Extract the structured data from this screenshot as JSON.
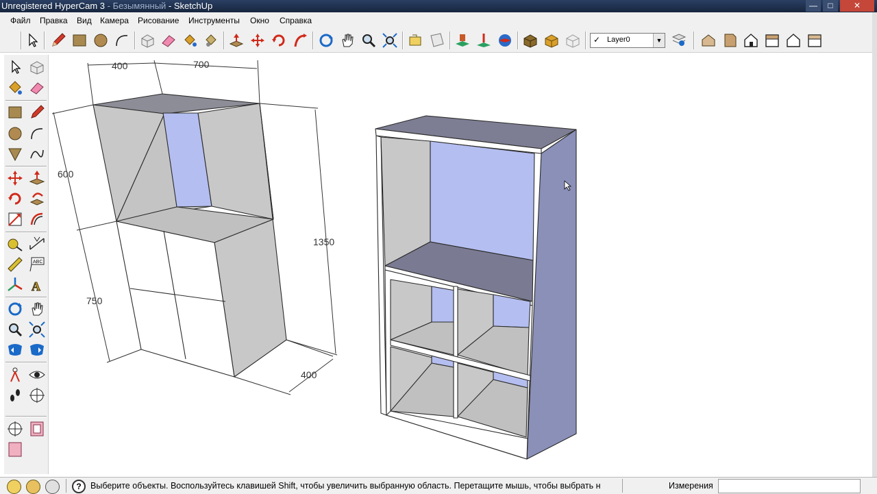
{
  "window": {
    "title_faded": "Unregistered HyperCam 3",
    "title_sep": " - ",
    "title_obscured": "Безымянный",
    "title_app": "SketchUp"
  },
  "menu": [
    "Файл",
    "Правка",
    "Вид",
    "Камера",
    "Рисование",
    "Инструменты",
    "Окно",
    "Справка"
  ],
  "toolbar": {
    "layer_value": "Layer0",
    "layer_check": "✓",
    "tools": [
      "select-tool",
      "pencil-tool",
      "rectangle-tool",
      "circle-tool",
      "arc-tool",
      "make-component-tool",
      "eraser-tool",
      "paint-bucket-tool",
      "pushpull-tool",
      "move-tool",
      "rotate-tool",
      "followme-tool",
      "orbit-tool",
      "pan-tool",
      "zoom-tool",
      "zoom-extents-tool",
      "previous-view",
      "next-view",
      "section-plane",
      "sandbox-tool",
      "web-globe",
      "layers",
      "components",
      "shadows",
      "layer-manager",
      "iso-view",
      "front-view",
      "right-view",
      "back-view",
      "top-view"
    ]
  },
  "drawing": {
    "dimensions": {
      "width_left": "400",
      "width_right": "700",
      "height_upper": "600",
      "height_lower": "750",
      "height_total": "1350",
      "depth": "400"
    },
    "colors": {
      "face_gray": "#c8c8c8",
      "face_blue": "#b4bef0",
      "face_top": "#7a7a92",
      "face_side": "#8a90b8",
      "edge": "#2a2a2a"
    }
  },
  "statusbar": {
    "hint": "Выберите объекты. Воспользуйтесь клавишей Shift, чтобы увеличить выбранную область. Перетащите мышь, чтобы выбрать н",
    "measure_label": "Измерения",
    "measure_value": ""
  }
}
